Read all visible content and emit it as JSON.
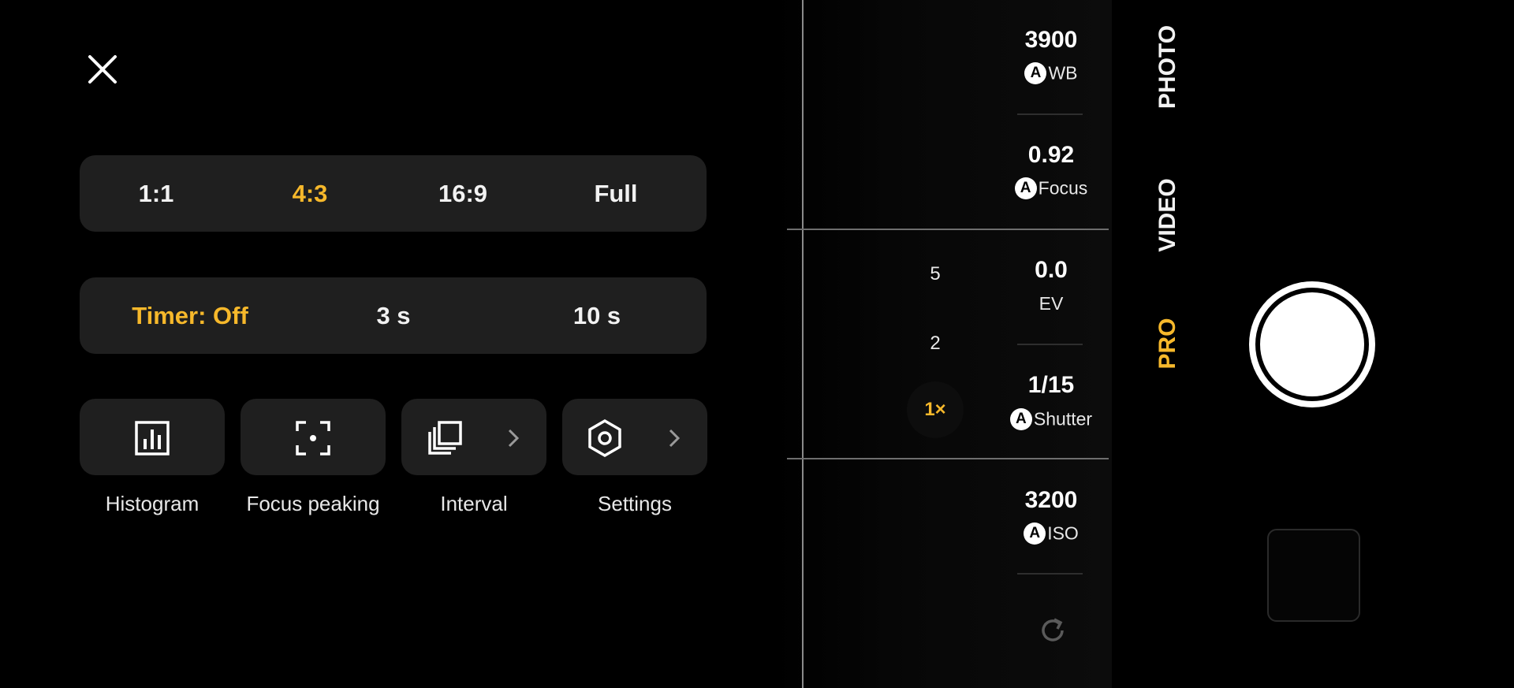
{
  "close": {
    "icon": "close-icon"
  },
  "aspect_ratio": {
    "options": [
      "1:1",
      "4:3",
      "16:9",
      "Full"
    ],
    "selected": "4:3"
  },
  "timer": {
    "options": [
      "Timer: Off",
      "3 s",
      "10 s"
    ],
    "selected": "Timer: Off"
  },
  "tools": [
    {
      "label": "Histogram",
      "icon": "histogram-icon"
    },
    {
      "label": "Focus peaking",
      "icon": "focus-peaking-icon"
    },
    {
      "label": "Interval",
      "icon": "interval-icon"
    },
    {
      "label": "Settings",
      "icon": "settings-icon"
    }
  ],
  "params": {
    "wb": {
      "value": "3900",
      "badge": "A",
      "label": "WB"
    },
    "focus": {
      "value": "0.92",
      "badge": "A",
      "label": "Focus"
    },
    "ev": {
      "value": "0.0",
      "label": "EV"
    },
    "shutter": {
      "value": "1/15",
      "badge": "A",
      "label": "Shutter"
    },
    "iso": {
      "value": "3200",
      "badge": "A",
      "label": "ISO"
    }
  },
  "zoom": {
    "levels": [
      "5",
      "2",
      "1×"
    ],
    "selected": "1×"
  },
  "modes": {
    "items": [
      "PHOTO",
      "VIDEO",
      "PRO"
    ],
    "selected": "PRO"
  },
  "colors": {
    "accent": "#f6b82b",
    "panel": "#1f1f1f",
    "background": "#000000"
  }
}
